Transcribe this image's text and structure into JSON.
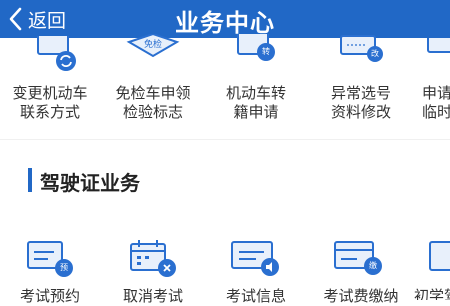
{
  "header": {
    "back_label": "返回",
    "title": "业务中心"
  },
  "vehicle_services": [
    {
      "line1": "变更机动车",
      "line2": "联系方式",
      "icon": "change-contact-icon"
    },
    {
      "line1": "免检车申领",
      "line2": "检验标志",
      "icon": "exempt-inspection-icon",
      "icon_text": "免检"
    },
    {
      "line1": "机动车转",
      "line2": "籍申请",
      "icon": "vehicle-transfer-icon",
      "badge": "转"
    },
    {
      "line1": "异常选号",
      "line2": "资料修改",
      "icon": "plate-selection-icon",
      "badge": "改"
    },
    {
      "line1": "申请",
      "line2": "临时",
      "icon": "temporary-plate-icon"
    }
  ],
  "section": {
    "title": "驾驶证业务"
  },
  "license_services": [
    {
      "label": "考试预约",
      "icon": "exam-booking-icon",
      "badge": "预"
    },
    {
      "label": "取消考试",
      "icon": "cancel-exam-icon"
    },
    {
      "label": "考试信息",
      "icon": "exam-info-icon"
    },
    {
      "label": "考试费缴纳",
      "icon": "exam-fee-icon",
      "badge": "缴"
    },
    {
      "label": "初学驾",
      "icon": "learner-permit-icon"
    }
  ],
  "colors": {
    "header": "#2168c6",
    "icon_blue": "#2a6fd0",
    "icon_light": "#e8f0fb"
  }
}
